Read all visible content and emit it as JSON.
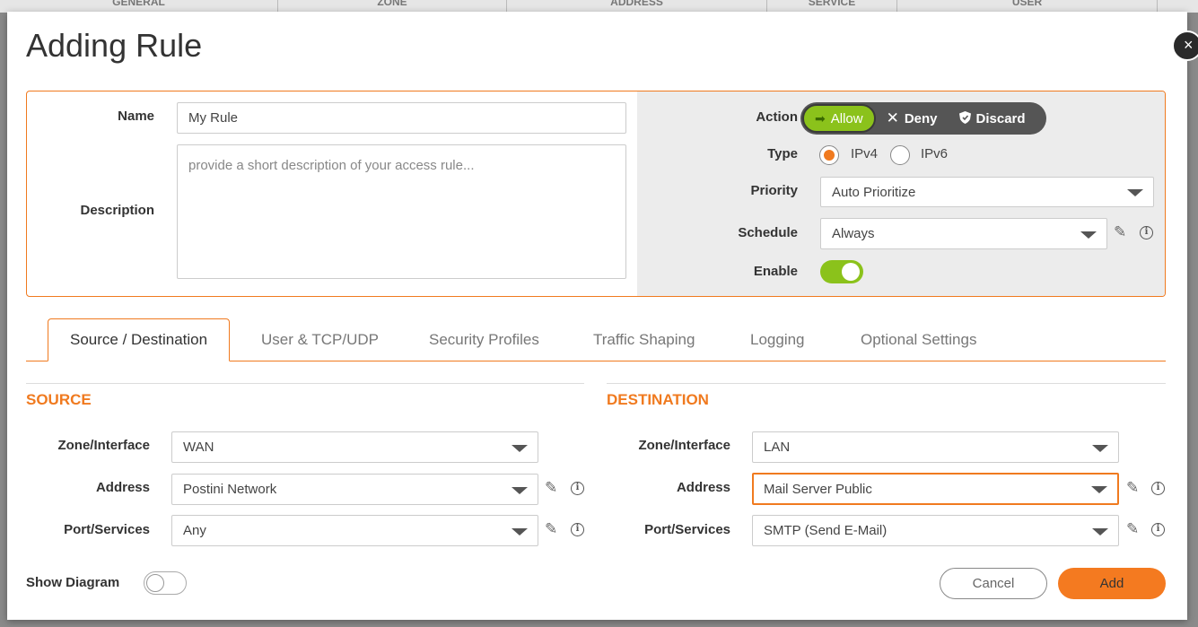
{
  "background_table": {
    "columns": [
      "GENERAL",
      "ZONE",
      "ADDRESS",
      "SERVICE",
      "USER"
    ]
  },
  "dialog": {
    "title": "Adding Rule",
    "close_icon": "×"
  },
  "general": {
    "name_label": "Name",
    "name_value": "My Rule",
    "description_label": "Description",
    "description_placeholder": "provide a short description of your access rule...",
    "action_label": "Action",
    "actions": [
      {
        "label": "Allow",
        "icon": "arrow-right-icon",
        "selected": true
      },
      {
        "label": "Deny",
        "icon": "x-icon",
        "selected": false
      },
      {
        "label": "Discard",
        "icon": "shield-icon",
        "selected": false
      }
    ],
    "type_label": "Type",
    "type_options": [
      "IPv4",
      "IPv6"
    ],
    "type_selected": "IPv4",
    "priority_label": "Priority",
    "priority_value": "Auto Prioritize",
    "schedule_label": "Schedule",
    "schedule_value": "Always",
    "enable_label": "Enable",
    "enable_on": true
  },
  "tabs": [
    "Source / Destination",
    "User & TCP/UDP",
    "Security Profiles",
    "Traffic Shaping",
    "Logging",
    "Optional Settings"
  ],
  "active_tab": "Source / Destination",
  "source": {
    "title": "SOURCE",
    "zone_label": "Zone/Interface",
    "zone_value": "WAN",
    "address_label": "Address",
    "address_value": "Postini Network",
    "port_label": "Port/Services",
    "port_value": "Any"
  },
  "destination": {
    "title": "DESTINATION",
    "zone_label": "Zone/Interface",
    "zone_value": "LAN",
    "address_label": "Address",
    "address_value": "Mail Server Public",
    "port_label": "Port/Services",
    "port_value": "SMTP (Send E-Mail)"
  },
  "footer": {
    "show_diagram_label": "Show Diagram",
    "show_diagram_on": false,
    "cancel_label": "Cancel",
    "add_label": "Add"
  },
  "colors": {
    "accent": "#f07a1f",
    "allow_green": "#8bc21b",
    "action_group_bg": "#555555"
  }
}
